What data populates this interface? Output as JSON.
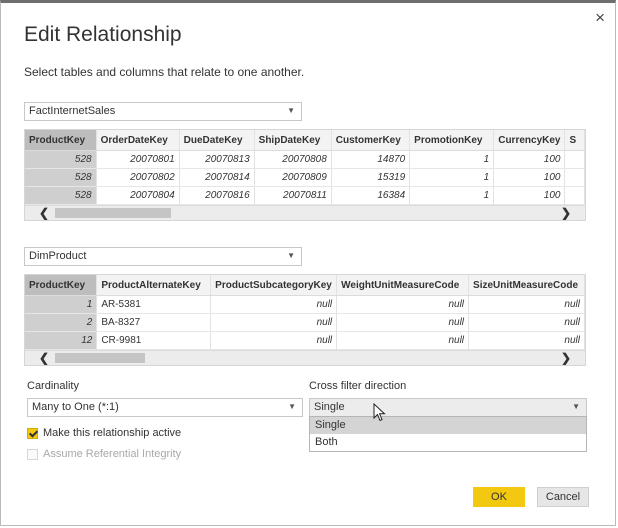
{
  "dialog": {
    "title": "Edit Relationship",
    "subtitle": "Select tables and columns that relate to one another.",
    "close_glyph": "×"
  },
  "table1": {
    "selected": "FactInternetSales",
    "columns": [
      "ProductKey",
      "OrderDateKey",
      "DueDateKey",
      "ShipDateKey",
      "CustomerKey",
      "PromotionKey",
      "CurrencyKey",
      "S"
    ],
    "rows": [
      [
        "528",
        "20070801",
        "20070813",
        "20070808",
        "14870",
        "1",
        "100",
        ""
      ],
      [
        "528",
        "20070802",
        "20070814",
        "20070809",
        "15319",
        "1",
        "100",
        ""
      ],
      [
        "528",
        "20070804",
        "20070816",
        "20070811",
        "16384",
        "1",
        "100",
        ""
      ]
    ]
  },
  "table2": {
    "selected": "DimProduct",
    "columns": [
      "ProductKey",
      "ProductAlternateKey",
      "ProductSubcategoryKey",
      "WeightUnitMeasureCode",
      "SizeUnitMeasureCode"
    ],
    "rows": [
      [
        "1",
        "AR-5381",
        "null",
        "null",
        "null"
      ],
      [
        "2",
        "BA-8327",
        "null",
        "null",
        "null"
      ],
      [
        "12",
        "CR-9981",
        "null",
        "null",
        "null"
      ]
    ]
  },
  "cardinality": {
    "label": "Cardinality",
    "value": "Many to One (*:1)"
  },
  "cross_filter": {
    "label": "Cross filter direction",
    "value": "Single",
    "options": [
      "Single",
      "Both"
    ]
  },
  "options": {
    "active_label": "Make this relationship active",
    "active_checked": true,
    "integrity_label": "Assume Referential Integrity",
    "integrity_checked": false
  },
  "buttons": {
    "ok": "OK",
    "cancel": "Cancel"
  },
  "scroll": {
    "left_glyph": "❮",
    "right_glyph": "❯"
  },
  "colors": {
    "accent": "#f2c811",
    "key_column": "#bdbdbd"
  }
}
